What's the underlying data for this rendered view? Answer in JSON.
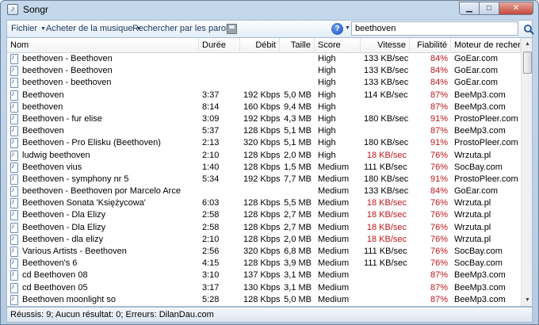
{
  "window": {
    "title": "Songr"
  },
  "toolbar": {
    "menu_file": "Fichier",
    "menu_buy": "Acheter de la musique",
    "lyrics": "Rechercher par les paroles",
    "search_value": "beethoven"
  },
  "columns": [
    "Nom",
    "Durée",
    "Débit",
    "Taille",
    "Score",
    "Vitesse",
    "Fiabilité",
    "Moteur de recher..."
  ],
  "rows": [
    {
      "nom": "beethoven - Beethoven",
      "duree": "",
      "debit": "",
      "taille": "",
      "score": "High",
      "vitesse": "133 KB/sec",
      "fiabilite": "84%",
      "moteur": "GoEar.com",
      "slow": false
    },
    {
      "nom": "beethoven - Beethoven",
      "duree": "",
      "debit": "",
      "taille": "",
      "score": "High",
      "vitesse": "133 KB/sec",
      "fiabilite": "84%",
      "moteur": "GoEar.com",
      "slow": false
    },
    {
      "nom": "beethoven - beethoven",
      "duree": "",
      "debit": "",
      "taille": "",
      "score": "High",
      "vitesse": "133 KB/sec",
      "fiabilite": "84%",
      "moteur": "GoEar.com",
      "slow": false
    },
    {
      "nom": "Beethoven",
      "duree": "3:37",
      "debit": "192 Kbps",
      "taille": "5,0 MB",
      "score": "High",
      "vitesse": "114 KB/sec",
      "fiabilite": "87%",
      "moteur": "BeeMp3.com",
      "slow": false
    },
    {
      "nom": "beethoven",
      "duree": "8:14",
      "debit": "160 Kbps",
      "taille": "9,4 MB",
      "score": "High",
      "vitesse": "",
      "fiabilite": "87%",
      "moteur": "BeeMp3.com",
      "slow": false
    },
    {
      "nom": "Beethoven - fur elise",
      "duree": "3:09",
      "debit": "192 Kbps",
      "taille": "4,3 MB",
      "score": "High",
      "vitesse": "180 KB/sec",
      "fiabilite": "91%",
      "moteur": "ProstoPleer.com",
      "slow": false
    },
    {
      "nom": "Beethoven",
      "duree": "5:37",
      "debit": "128 Kbps",
      "taille": "5,1 MB",
      "score": "High",
      "vitesse": "",
      "fiabilite": "87%",
      "moteur": "BeeMp3.com",
      "slow": false
    },
    {
      "nom": "Beethoven - Pro Elisku (Beethoven)",
      "duree": "2:13",
      "debit": "320 Kbps",
      "taille": "5,1 MB",
      "score": "High",
      "vitesse": "180 KB/sec",
      "fiabilite": "91%",
      "moteur": "ProstoPleer.com",
      "slow": false
    },
    {
      "nom": "ludwig beethoven",
      "duree": "2:10",
      "debit": "128 Kbps",
      "taille": "2,0 MB",
      "score": "High",
      "vitesse": "18 KB/sec",
      "fiabilite": "76%",
      "moteur": "Wrzuta.pl",
      "slow": true
    },
    {
      "nom": "Beethoven vius",
      "duree": "1:40",
      "debit": "128 Kbps",
      "taille": "1,5 MB",
      "score": "Medium",
      "vitesse": "111 KB/sec",
      "fiabilite": "76%",
      "moteur": "SocBay.com",
      "slow": false
    },
    {
      "nom": "Beethoven - symphony nr 5",
      "duree": "5:34",
      "debit": "192 Kbps",
      "taille": "7,7 MB",
      "score": "Medium",
      "vitesse": "180 KB/sec",
      "fiabilite": "91%",
      "moteur": "ProstoPleer.com",
      "slow": false
    },
    {
      "nom": "beethoven - Beethoven por Marcelo Arce",
      "duree": "",
      "debit": "",
      "taille": "",
      "score": "Medium",
      "vitesse": "133 KB/sec",
      "fiabilite": "84%",
      "moteur": "GoEar.com",
      "slow": false
    },
    {
      "nom": "Beethoven Sonata 'Księżycowa'",
      "duree": "6:03",
      "debit": "128 Kbps",
      "taille": "5,5 MB",
      "score": "Medium",
      "vitesse": "18 KB/sec",
      "fiabilite": "76%",
      "moteur": "Wrzuta.pl",
      "slow": true
    },
    {
      "nom": "Beethoven - Dla Elizy",
      "duree": "2:58",
      "debit": "128 Kbps",
      "taille": "2,7 MB",
      "score": "Medium",
      "vitesse": "18 KB/sec",
      "fiabilite": "76%",
      "moteur": "Wrzuta.pl",
      "slow": true
    },
    {
      "nom": "Beethoven - Dla Elizy",
      "duree": "2:58",
      "debit": "128 Kbps",
      "taille": "2,7 MB",
      "score": "Medium",
      "vitesse": "18 KB/sec",
      "fiabilite": "76%",
      "moteur": "Wrzuta.pl",
      "slow": true
    },
    {
      "nom": "Beethoven - dla elizy",
      "duree": "2:10",
      "debit": "128 Kbps",
      "taille": "2,0 MB",
      "score": "Medium",
      "vitesse": "18 KB/sec",
      "fiabilite": "76%",
      "moteur": "Wrzuta.pl",
      "slow": true
    },
    {
      "nom": "Various Artists - Beethoven",
      "duree": "2:56",
      "debit": "320 Kbps",
      "taille": "6,8 MB",
      "score": "Medium",
      "vitesse": "111 KB/sec",
      "fiabilite": "76%",
      "moteur": "SocBay.com",
      "slow": false
    },
    {
      "nom": "Beethoven's 6",
      "duree": "4:15",
      "debit": "128 Kbps",
      "taille": "3,9 MB",
      "score": "Medium",
      "vitesse": "111 KB/sec",
      "fiabilite": "76%",
      "moteur": "SocBay.com",
      "slow": false
    },
    {
      "nom": "cd Beethoven 08",
      "duree": "3:10",
      "debit": "137 Kbps",
      "taille": "3,1 MB",
      "score": "Medium",
      "vitesse": "",
      "fiabilite": "87%",
      "moteur": "BeeMp3.com",
      "slow": false
    },
    {
      "nom": "cd Beethoven 05",
      "duree": "3:17",
      "debit": "130 Kbps",
      "taille": "3,1 MB",
      "score": "Medium",
      "vitesse": "",
      "fiabilite": "87%",
      "moteur": "BeeMp3.com",
      "slow": false
    },
    {
      "nom": "Beethoven moonlight so",
      "duree": "5:28",
      "debit": "128 Kbps",
      "taille": "5,0 MB",
      "score": "Medium",
      "vitesse": "",
      "fiabilite": "87%",
      "moteur": "BeeMp3.com",
      "slow": false
    }
  ],
  "status": {
    "text": "Réussis: 9; Aucun résultat: 0; Erreurs: DilanDau.com"
  },
  "colors": {
    "slow_speed": "#c0161b",
    "reliability": "#c0161b"
  },
  "icons": {
    "app": "songr-app-icon",
    "row": "music-file-icon",
    "help": "help-icon",
    "save": "save-icon",
    "search": "search-icon"
  }
}
